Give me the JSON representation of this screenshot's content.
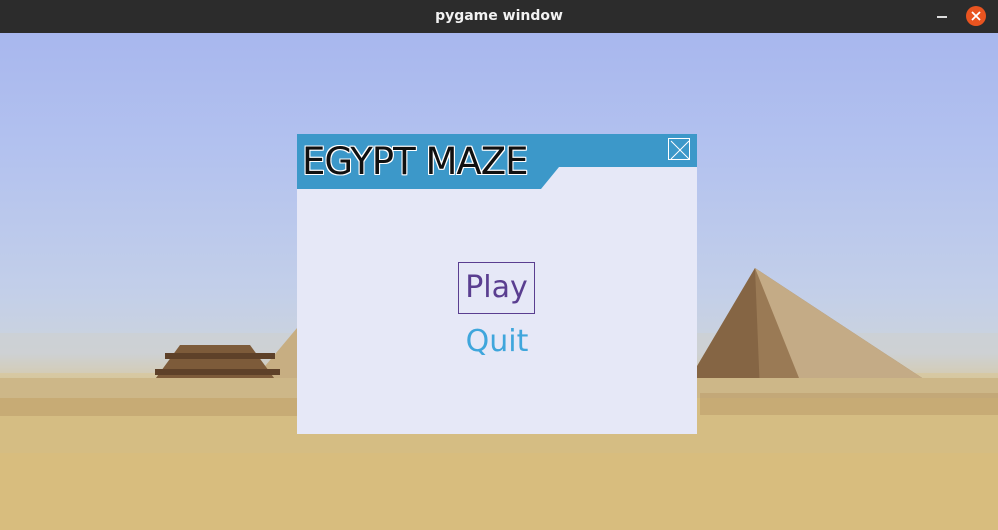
{
  "window": {
    "title": "pygame window"
  },
  "dialog": {
    "title": "EGYPT MAZE",
    "header_color": "#3c98c9",
    "background_color": "#e6e8f7"
  },
  "menu": {
    "items": [
      {
        "label": "Play",
        "selected": true,
        "color": "#5a3e90"
      },
      {
        "label": "Quit",
        "selected": false,
        "color": "#3fa6dc"
      }
    ]
  }
}
